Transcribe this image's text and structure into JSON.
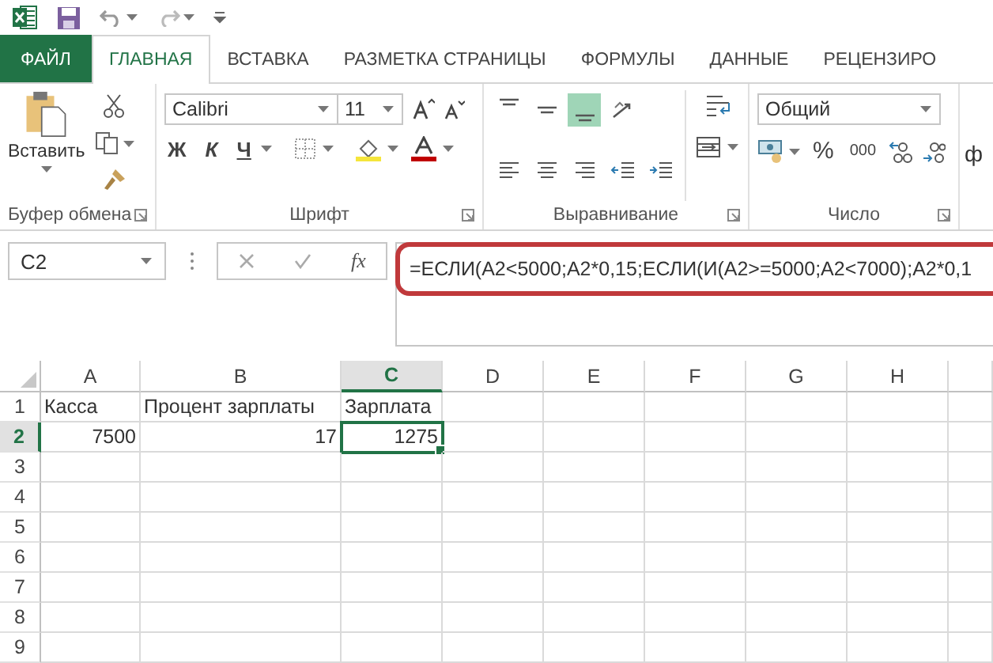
{
  "tabs": [
    {
      "label": "ФАЙЛ",
      "kind": "file",
      "selected": false
    },
    {
      "label": "ГЛАВНАЯ",
      "kind": "tab",
      "selected": true
    },
    {
      "label": "ВСТАВКА",
      "kind": "tab",
      "selected": false
    },
    {
      "label": "РАЗМЕТКА СТРАНИЦЫ",
      "kind": "tab",
      "selected": false
    },
    {
      "label": "ФОРМУЛЫ",
      "kind": "tab",
      "selected": false
    },
    {
      "label": "ДАННЫЕ",
      "kind": "tab",
      "selected": false
    },
    {
      "label": "РЕЦЕНЗИРО",
      "kind": "tab",
      "selected": false
    }
  ],
  "ribbon": {
    "clipboard": {
      "paste_label": "Вставить",
      "label": "Буфер обмена"
    },
    "font": {
      "font_name": "Calibri",
      "font_size": "11",
      "bold": "Ж",
      "italic": "К",
      "underline": "Ч",
      "label": "Шрифт"
    },
    "alignment": {
      "buttons": [
        {
          "kind": "align-top",
          "selected": false
        },
        {
          "kind": "align-middle",
          "selected": false
        },
        {
          "kind": "align-bottom",
          "selected": true
        },
        {
          "kind": "orientation",
          "selected": false
        },
        {
          "kind": "align-left",
          "selected": false
        },
        {
          "kind": "align-center",
          "selected": false
        },
        {
          "kind": "align-right",
          "selected": false
        },
        {
          "kind": "outdent",
          "selected": false
        },
        {
          "kind": "indent",
          "selected": false
        }
      ],
      "label": "Выравнивание"
    },
    "number": {
      "format": "Общий",
      "percent": "%",
      "thousands": "000",
      "label": "Число"
    },
    "next_group_fragment": "ф"
  },
  "formula_bar": {
    "name_box": "C2",
    "fx": "fx",
    "formula": "=ЕСЛИ(A2<5000;A2*0,15;ЕСЛИ(И(A2>=5000;A2<7000);A2*0,1",
    "highlighted": true
  },
  "columns": [
    {
      "label": "A",
      "selected": false
    },
    {
      "label": "B",
      "selected": false
    },
    {
      "label": "C",
      "selected": true
    },
    {
      "label": "D",
      "selected": false
    },
    {
      "label": "E",
      "selected": false
    },
    {
      "label": "F",
      "selected": false
    },
    {
      "label": "G",
      "selected": false
    },
    {
      "label": "H",
      "selected": false
    }
  ],
  "rows": [
    {
      "number": "1",
      "selected": false,
      "cells": [
        {
          "value": "Касса",
          "numeric": false,
          "selected": false
        },
        {
          "value": "Процент зарплаты",
          "numeric": false,
          "selected": false
        },
        {
          "value": "Зарплата",
          "numeric": false,
          "selected": false
        }
      ]
    },
    {
      "number": "2",
      "selected": true,
      "cells": [
        {
          "value": "7500",
          "numeric": true,
          "selected": false
        },
        {
          "value": "17",
          "numeric": true,
          "selected": false
        },
        {
          "value": "1275",
          "numeric": true,
          "selected": true
        }
      ]
    },
    {
      "number": "3",
      "selected": false,
      "cells": []
    },
    {
      "number": "4",
      "selected": false,
      "cells": []
    },
    {
      "number": "5",
      "selected": false,
      "cells": []
    },
    {
      "number": "6",
      "selected": false,
      "cells": []
    },
    {
      "number": "7",
      "selected": false,
      "cells": []
    },
    {
      "number": "8",
      "selected": false,
      "cells": []
    },
    {
      "number": "9",
      "selected": false,
      "cells": []
    }
  ]
}
